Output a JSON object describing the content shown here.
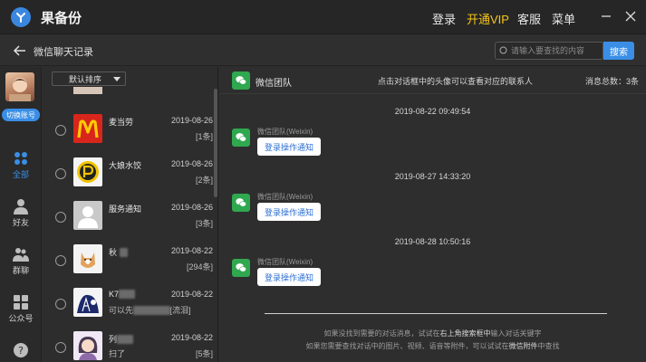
{
  "app": {
    "title": "果备份"
  },
  "titlebar": {
    "login": "登录",
    "vip": "开通VIP",
    "service": "客服",
    "menu": "菜单"
  },
  "subbar": {
    "title": "微信聊天记录",
    "search_placeholder": "请输入要查找的内容",
    "search_button": "搜索"
  },
  "leftnav": {
    "switch_label": "切换账号",
    "items": [
      {
        "label": "全部"
      },
      {
        "label": "好友"
      },
      {
        "label": "群聊"
      },
      {
        "label": "公众号"
      }
    ]
  },
  "convlist": {
    "sort_label": "默认排序",
    "rows": [
      {
        "name": "麦当劳",
        "date": "2019-08-26",
        "count": "[1条]",
        "sub": ""
      },
      {
        "name": "大娘水饺",
        "date": "2019-08-26",
        "count": "[2条]",
        "sub": ""
      },
      {
        "name": "服务通知",
        "date": "2019-08-26",
        "count": "[3条]",
        "sub": ""
      },
      {
        "name": "秋",
        "date": "2019-08-22",
        "count": "[294条]",
        "sub": ""
      },
      {
        "name": "K7",
        "date": "2019-08-22",
        "count": "",
        "sub": "可以先",
        "sub_tail": "[流泪]"
      },
      {
        "name": "列",
        "date": "2019-08-22",
        "count": "[5条]",
        "sub": "扫了"
      }
    ]
  },
  "chat": {
    "title": "微信团队",
    "hint": "点击对话框中的头像可以查看对应的联系人",
    "total": "消息总数：3条",
    "messages": [
      {
        "time": "2019-08-22 09:49:54",
        "sender": "微信团队(Weixin)",
        "text": "登录操作通知"
      },
      {
        "time": "2019-08-27 14:33:20",
        "sender": "微信团队(Weixin)",
        "text": "登录操作通知"
      },
      {
        "time": "2019-08-28 10:50:16",
        "sender": "微信团队(Weixin)",
        "text": "登录操作通知"
      }
    ],
    "tip1_a": "如果没找到需要的对话消息，试试在",
    "tip1_b": "右上角搜索框中",
    "tip1_c": "输入对话关键字",
    "tip2_a": "如果您需要查找对话中的图片、视频、语音等附件，可以试试在",
    "tip2_b": "微信附件",
    "tip2_c": "中查找"
  },
  "colors": {
    "accent": "#3a8ee6",
    "vip": "#f5c518",
    "wechat": "#2fa84f",
    "link": "#2d6fd1"
  }
}
